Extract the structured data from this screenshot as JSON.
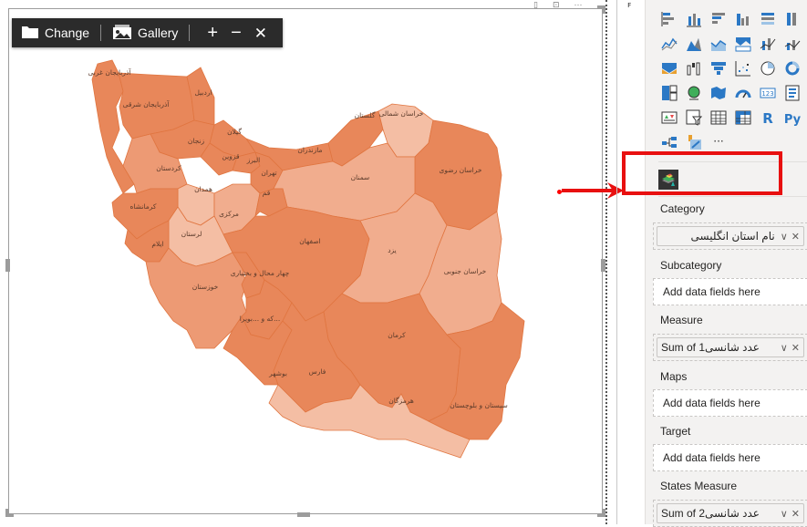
{
  "toolbar": {
    "change_label": "Change",
    "gallery_label": "Gallery",
    "zoom_in": "+",
    "zoom_out": "−",
    "reset": "✕"
  },
  "map": {
    "colors": {
      "dark": "#e8875a",
      "medium": "#ed9a74",
      "light": "#f1ad8e",
      "lightest": "#f4bea4",
      "border": "#e07540"
    },
    "provinces": [
      {
        "name": "آذربایجان غربی",
        "shade": "dark"
      },
      {
        "name": "آذربایجان شرقی",
        "shade": "dark"
      },
      {
        "name": "اردبیل",
        "shade": "dark"
      },
      {
        "name": "گیلان",
        "shade": "dark"
      },
      {
        "name": "زنجان",
        "shade": "dark"
      },
      {
        "name": "قزوین",
        "shade": "dark"
      },
      {
        "name": "البرز",
        "shade": "dark"
      },
      {
        "name": "تهران",
        "shade": "dark"
      },
      {
        "name": "مازندران",
        "shade": "dark"
      },
      {
        "name": "گلستان",
        "shade": "dark"
      },
      {
        "name": "خراسان شمالی",
        "shade": "lightest"
      },
      {
        "name": "خراسان رضوی",
        "shade": "dark"
      },
      {
        "name": "سمنان",
        "shade": "light"
      },
      {
        "name": "کردستان",
        "shade": "medium"
      },
      {
        "name": "همدان",
        "shade": "lightest"
      },
      {
        "name": "کرمانشاه",
        "shade": "dark"
      },
      {
        "name": "مرکزی",
        "shade": "light"
      },
      {
        "name": "قم",
        "shade": "dark"
      },
      {
        "name": "لرستان",
        "shade": "lightest"
      },
      {
        "name": "ایلام",
        "shade": "dark"
      },
      {
        "name": "اصفهان",
        "shade": "dark"
      },
      {
        "name": "خوزستان",
        "shade": "medium"
      },
      {
        "name": "چهار محال و بختیاری",
        "shade": "dark"
      },
      {
        "name": "...که و ...بویرا",
        "shade": "dark"
      },
      {
        "name": "یزد",
        "shade": "light"
      },
      {
        "name": "خراسان جنوبی",
        "shade": "light"
      },
      {
        "name": "کرمان",
        "shade": "dark"
      },
      {
        "name": "بوشهر",
        "shade": "dark"
      },
      {
        "name": "فارس",
        "shade": "dark"
      },
      {
        "name": "هرمزگان",
        "shade": "lightest"
      },
      {
        "name": "سیستان و بلوچستان",
        "shade": "dark"
      }
    ]
  },
  "visualizations": {
    "icons": [
      "stacked-bar-icon",
      "stacked-column-icon",
      "clustered-bar-icon",
      "clustered-column-icon",
      "100-stacked-bar-icon",
      "100-stacked-column-icon",
      "line-chart-icon",
      "area-chart-icon",
      "stacked-area-icon",
      "ribbon-chart-icon",
      "line-clustered-column-icon",
      "line-stacked-column-icon",
      "ribbon-icon",
      "waterfall-icon",
      "funnel-icon",
      "scatter-icon",
      "pie-chart-icon",
      "donut-chart-icon",
      "treemap-icon",
      "map-icon",
      "filled-map-icon",
      "gauge-icon",
      "card-icon",
      "multi-row-card-icon",
      "kpi-icon",
      "slicer-icon",
      "table-icon",
      "matrix-icon",
      "r-visual-icon",
      "python-visual-icon",
      "decomposition-tree-icon",
      "key-influencers-icon",
      "more-icon"
    ],
    "r_label": "R",
    "py_label": "Py",
    "more_label": "···"
  },
  "fields": {
    "category": {
      "label": "Category",
      "value": "نام استان انگلیسی"
    },
    "subcategory": {
      "label": "Subcategory",
      "placeholder": "Add data fields here"
    },
    "measure": {
      "label": "Measure",
      "value": "Sum of عدد شانسی1"
    },
    "maps": {
      "label": "Maps",
      "placeholder": "Add data fields here"
    },
    "target": {
      "label": "Target",
      "placeholder": "Add data fields here"
    },
    "states_measure": {
      "label": "States Measure",
      "value": "Sum of عدد شانسی2"
    }
  },
  "pill_controls": {
    "expand": "∨",
    "remove": "✕"
  }
}
